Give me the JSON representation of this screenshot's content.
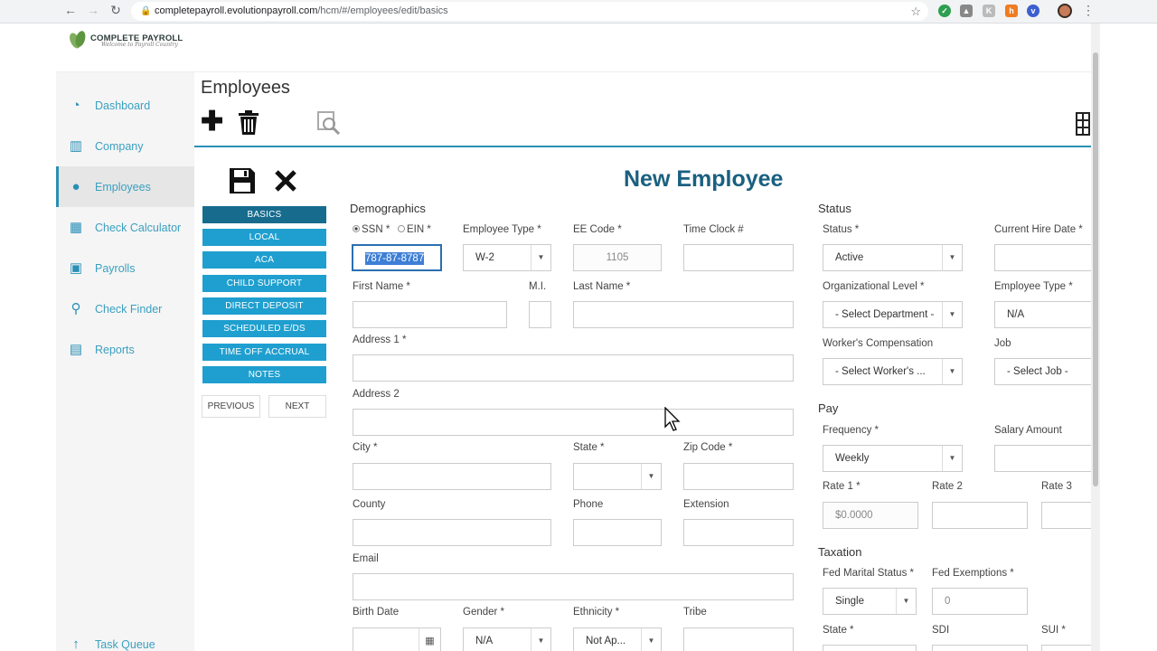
{
  "browser": {
    "url_domain": "completepayroll.evolutionpayroll.com",
    "url_path": "/hcm/#/employees/edit/basics"
  },
  "brand": {
    "name": "COMPLETE PAYROLL",
    "tagline": "Welcome to Payroll Country"
  },
  "sidebar": {
    "items": [
      {
        "label": "Dashboard",
        "icon": "dashboard-icon"
      },
      {
        "label": "Company",
        "icon": "company-icon"
      },
      {
        "label": "Employees",
        "icon": "employees-icon",
        "active": true
      },
      {
        "label": "Check Calculator",
        "icon": "calculator-icon"
      },
      {
        "label": "Payrolls",
        "icon": "payrolls-icon"
      },
      {
        "label": "Check Finder",
        "icon": "search-icon"
      },
      {
        "label": "Reports",
        "icon": "reports-icon"
      }
    ],
    "task_queue": "Task Queue"
  },
  "main": {
    "title": "Employees",
    "form_title": "New Employee"
  },
  "subnav": {
    "items": [
      "BASICS",
      "LOCAL",
      "ACA",
      "CHILD SUPPORT",
      "DIRECT DEPOSIT",
      "SCHEDULED E/DS",
      "TIME OFF ACCRUAL",
      "NOTES"
    ],
    "previous": "PREVIOUS",
    "next": "NEXT"
  },
  "demographics": {
    "section": "Demographics",
    "ssn_label": "SSN *",
    "ein_label": "EIN *",
    "ssn_value": "787-87-8787",
    "employee_type_label": "Employee Type *",
    "employee_type_value": "W-2",
    "ee_code_label": "EE Code *",
    "ee_code_value": "1105",
    "time_clock_label": "Time Clock #",
    "first_name_label": "First Name *",
    "mi_label": "M.I.",
    "last_name_label": "Last Name *",
    "address1_label": "Address 1 *",
    "address2_label": "Address 2",
    "city_label": "City *",
    "state_label": "State *",
    "zip_label": "Zip Code *",
    "county_label": "County",
    "phone_label": "Phone",
    "extension_label": "Extension",
    "email_label": "Email",
    "birth_date_label": "Birth Date",
    "gender_label": "Gender *",
    "gender_value": "N/A",
    "ethnicity_label": "Ethnicity *",
    "ethnicity_value": "Not Ap...",
    "tribe_label": "Tribe"
  },
  "status": {
    "section": "Status",
    "status_label": "Status *",
    "status_value": "Active",
    "hire_date_label": "Current Hire Date *",
    "org_level_label": "Organizational Level *",
    "org_level_value": "- Select Department -",
    "employee_type_label": "Employee Type *",
    "employee_type_value": "N/A",
    "workers_comp_label": "Worker's Compensation",
    "workers_comp_value": "- Select Worker's ...",
    "job_label": "Job",
    "job_value": "- Select Job -"
  },
  "pay": {
    "section": "Pay",
    "frequency_label": "Frequency *",
    "frequency_value": "Weekly",
    "salary_label": "Salary Amount",
    "rate1_label": "Rate 1 *",
    "rate1_value": "$0.0000",
    "rate2_label": "Rate 2",
    "rate3_label": "Rate 3"
  },
  "taxation": {
    "section": "Taxation",
    "fed_marital_label": "Fed Marital Status *",
    "fed_marital_value": "Single",
    "fed_exemptions_label": "Fed Exemptions *",
    "fed_exemptions_value": "0",
    "state_label": "State *",
    "sdi_label": "SDI",
    "sui_label": "SUI *"
  }
}
